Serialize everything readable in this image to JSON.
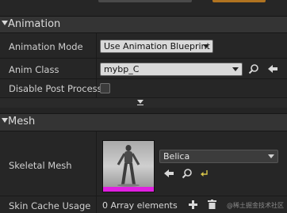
{
  "sections": {
    "animation": {
      "title": "Animation"
    },
    "mesh": {
      "title": "Mesh"
    }
  },
  "animation": {
    "mode_label": "Animation Mode",
    "mode_value": "Use Animation Blueprint",
    "anim_class_label": "Anim Class",
    "anim_class_value": "mybp_C",
    "disable_pp_label": "Disable Post Process",
    "disable_pp_checked": false
  },
  "mesh": {
    "skeletal_mesh_label": "Skeletal Mesh",
    "skeletal_mesh_value": "Belica",
    "skin_cache_label": "Skin Cache Usage",
    "skin_cache_value": "0 Array elements"
  },
  "watermark": "@稀土掘金技术社区",
  "icons": {
    "browse": "magnifier-icon",
    "use_selected": "left-arrow-icon",
    "reset": "reset-arrow-icon",
    "add": "plus-icon",
    "delete": "trash-icon",
    "collapse": "chevron-down-icon",
    "expand_advanced": "expand-advanced-icon"
  },
  "colors": {
    "panel_bg": "#242424",
    "header_bg": "#343434",
    "combo_light": "#d9d9d9",
    "combo_dark": "#3c3c3c",
    "accent_orange": "#b07320",
    "thumbnail_strip": "#e020e0",
    "reset_icon": "#d8c64a"
  }
}
